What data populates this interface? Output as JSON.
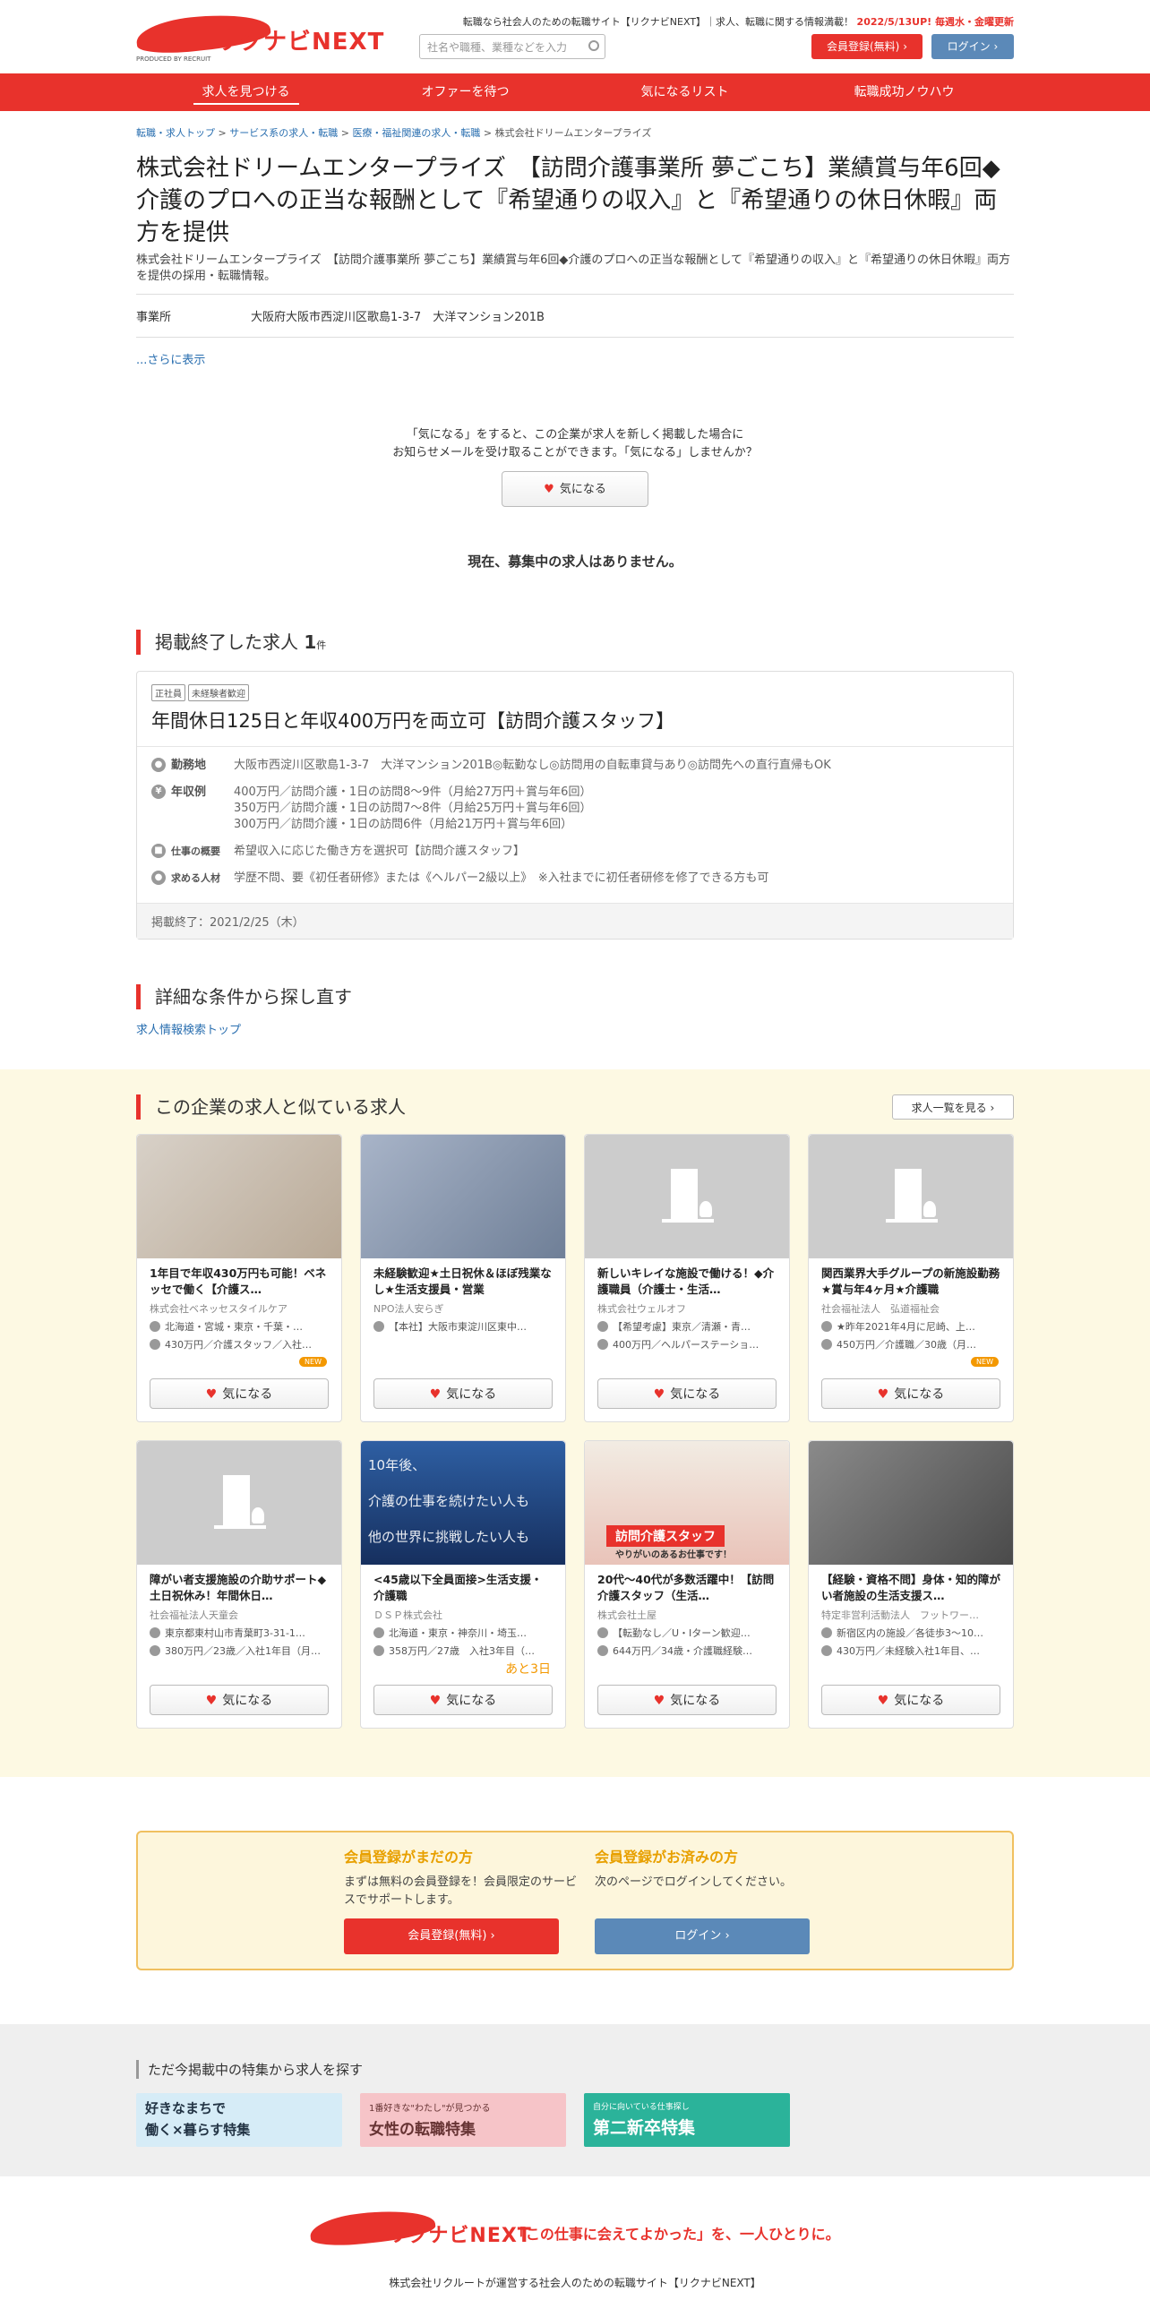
{
  "header": {
    "logo_text": "リクナビNEXT",
    "logo_sub": "PRODUCED BY RECRUIT",
    "tagline": "転職なら社会人のための転職サイト【リクナビNEXT】｜求人、転職に関する情報満載！",
    "update": "2022/5/13UP! 毎週水・金曜更新",
    "search_placeholder": "社名や職種、業種などを入力",
    "register_label": "会員登録(無料)",
    "login_label": "ログイン"
  },
  "nav": [
    "求人を見つける",
    "オファーを待つ",
    "気になるリスト",
    "転職成功ノウハウ"
  ],
  "breadcrumb": [
    "転職・求人トップ",
    "サービス系の求人・転職",
    "医療・福祉関連の求人・転職",
    "株式会社ドリームエンタープライズ"
  ],
  "company": {
    "title": "株式会社ドリームエンタープライズ　【訪問介護事業所 夢ごこち】業績賞与年6回◆介護のプロへの正当な報酬として『希望通りの収入』と『希望通りの休日休暇』両方を提供",
    "desc": "株式会社ドリームエンタープライズ　【訪問介護事業所 夢ごこち】業績賞与年6回◆介護のプロへの正当な報酬として『希望通りの収入』と『希望通りの休日休暇』両方を提供の採用・転職情報。",
    "office_label": "事業所",
    "office_value": "大阪府大阪市西淀川区歌島1-3-7　大洋マンション201B",
    "more": "...さらに表示"
  },
  "favorite": {
    "text1": "「気になる」をすると、この企業が求人を新しく掲載した場合に",
    "text2": "お知らせメールを受け取ることができます。「気になる」しませんか？",
    "button": "気になる"
  },
  "no_jobs": "現在、募集中の求人はありません。",
  "ended": {
    "title": "掲載終了した求人",
    "count": "1",
    "unit": "件",
    "tags": [
      "正社員",
      "未経験者歓迎"
    ],
    "job_title": "年間休日125日と年収400万円を両立可【訪問介護スタッフ】",
    "location_label": "勤務地",
    "location": "大阪市西淀川区歌島1-3-7　大洋マンション201B◎転勤なし◎訪問用の自転車貸与あり◎訪問先への直行直帰もOK",
    "salary_label": "年収例",
    "salary": [
      "400万円／訪問介護・1日の訪問8～9件（月給27万円＋賞与年6回）",
      "350万円／訪問介護・1日の訪問7～8件（月給25万円＋賞与年6回）",
      "300万円／訪問介護・1日の訪問6件（月給21万円＋賞与年6回）"
    ],
    "work_label": "仕事の概要",
    "work": "希望収入に応じた働き方を選択可【訪問介護スタッフ】",
    "req_label": "求める人材",
    "req": "学歴不問、要《初任者研修》または《ヘルパー2級以上》　※入社までに初任者研修を修了できる方も可",
    "posted": "掲載終了：2021/2/25（木）"
  },
  "search_again": {
    "title": "詳細な条件から探し直す",
    "link": "求人情報検索トップ"
  },
  "similar": {
    "title": "この企業の求人と似ている求人",
    "list_button": "求人一覧を見る",
    "cards": [
      {
        "title": "1年目で年収430万円も可能！ベネッセで働く【介護ス…",
        "company": "株式会社ベネッセスタイルケア",
        "loc": "北海道・宮城・東京・千葉・…",
        "sal": "430万円／介護スタッフ／入社…",
        "badge": "NEW",
        "btn": "気になる"
      },
      {
        "title": "未経験歓迎★土日祝休＆ほぼ残業なし★生活支援員・営業",
        "company": "NPO法人安らぎ",
        "loc": "【本社】大阪市東淀川区東中…",
        "sal": "",
        "badge": "",
        "btn": "気になる"
      },
      {
        "title": "新しいキレイな施設で働ける！◆介護職員（介護士・生活…",
        "company": "株式会社ウェルオフ",
        "loc": "【希望考慮】東京／清瀬・青…",
        "sal": "400万円／ヘルパーステーショ…",
        "badge": "",
        "btn": "気になる"
      },
      {
        "title": "関西業界大手グループの新施設勤務★賞与年4ヶ月★介護職",
        "company": "社会福祉法人　弘道福祉会",
        "loc": "★昨年2021年4月に尼崎、上…",
        "sal": "450万円／介護職／30歳（月…",
        "badge": "NEW",
        "btn": "気になる"
      },
      {
        "title": "障がい者支援施設の介助サポート◆土日祝休み！年間休日…",
        "company": "社会福祉法人天童会",
        "loc": "東京都東村山市青葉町3-31-1…",
        "sal": "380万円／23歳／入社1年目（月…",
        "badge": "",
        "btn": "気になる"
      },
      {
        "title": "<45歳以下全員面接>生活支援・介護職",
        "company": "ＤＳＰ株式会社",
        "loc": "北海道・東京・神奈川・埼玉…",
        "sal": "358万円／27歳　入社3年目（…",
        "badge": "あと3日",
        "btn": "気になる"
      },
      {
        "title": "20代～40代が多数活躍中！【訪問介護スタッフ（生活…",
        "company": "株式会社土屋",
        "loc": "【転勤なし／U・Iターン歓迎…",
        "sal": "644万円／34歳・介護職経験…",
        "badge": "",
        "btn": "気になる"
      },
      {
        "title": "【経験・資格不問】身体・知的障がい者施設の生活支援ス…",
        "company": "特定非営利活動法人　フットワー…",
        "loc": "新宿区内の施設／各徒歩3～10…",
        "sal": "430万円／未経験入社1年目、…",
        "badge": "",
        "btn": "気になる"
      }
    ],
    "thumb_texts": [
      "10年後、",
      "介護の仕事を続けたい人も",
      "他の世界に挑戦したい人も"
    ],
    "banner_tag": "訪問介護スタッフ",
    "banner_sub": "やりがいのあるお仕事です！"
  },
  "member": {
    "t1": "会員登録がまだの方",
    "d1": "まずは無料の会員登録を！会員限定のサービスでサポートします。",
    "b1": "会員登録(無料)",
    "t2": "会員登録がお済みの方",
    "d2": "次のページでログインしてください。",
    "b2": "ログイン"
  },
  "features": {
    "title": "ただ今掲載中の特集から求人を探す",
    "banners": [
      {
        "line1": "好きなまちで",
        "line2": "働く×暮らす特集",
        "color": "#d6ecf7"
      },
      {
        "line1": "1番好きな\"わたし\"が見つかる",
        "line2": "女性の転職特集",
        "color": "#f6c4c8"
      },
      {
        "line1": "自分に向いている仕事探し",
        "line2": "第二新卒特集",
        "color": "#2bb39a"
      }
    ]
  },
  "footer": {
    "slogan": "「この仕事に会えてよかった」を、一人ひとりに。",
    "copy": "株式会社リクルートが運営する社会人のための転職サイト【リクナビNEXT】"
  },
  "colors": {
    "brand": "#e8322c",
    "accent": "#f39800",
    "login": "#5b89b8",
    "similar_bg": "#fdf9e3"
  }
}
